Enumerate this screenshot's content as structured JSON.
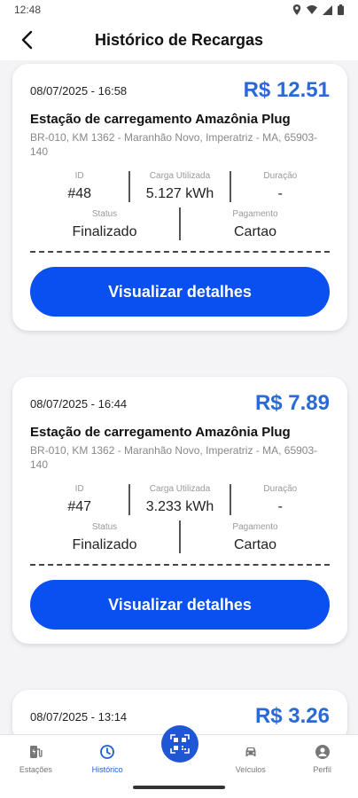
{
  "status_bar": {
    "time": "12:48"
  },
  "header": {
    "title": "Histórico de Recargas"
  },
  "labels": {
    "id": "ID",
    "energy": "Carga Utilizada",
    "duration": "Duração",
    "status": "Status",
    "payment": "Pagamento",
    "details_button": "Visualizar detalhes"
  },
  "recharges": [
    {
      "date": "08/07/2025 - 16:58",
      "amount": "R$ 12.51",
      "station": "Estação de carregamento Amazônia Plug",
      "address": "BR-010, KM 1362 - Maranhão Novo, Imperatriz - MA, 65903-140",
      "id": "#48",
      "energy": "5.127 kWh",
      "duration": "-",
      "status": "Finalizado",
      "payment": "Cartao"
    },
    {
      "date": "08/07/2025 - 16:44",
      "amount": "R$ 7.89",
      "station": "Estação de carregamento Amazônia Plug",
      "address": "BR-010, KM 1362 - Maranhão Novo, Imperatriz - MA, 65903-140",
      "id": "#47",
      "energy": "3.233 kWh",
      "duration": "-",
      "status": "Finalizado",
      "payment": "Cartao"
    },
    {
      "date": "08/07/2025 - 13:14",
      "amount": "R$ 3.26"
    }
  ],
  "bottom_nav": {
    "items": [
      {
        "label": "Estações",
        "icon": "ev-station-icon"
      },
      {
        "label": "Histórico",
        "icon": "clock-icon",
        "active": true
      },
      {
        "label": "Veículos",
        "icon": "car-icon"
      },
      {
        "label": "Perfil",
        "icon": "person-icon"
      }
    ]
  },
  "colors": {
    "accent": "#0a4ff0",
    "amount": "#2a6ad6",
    "active_nav": "#1f5fd6"
  }
}
